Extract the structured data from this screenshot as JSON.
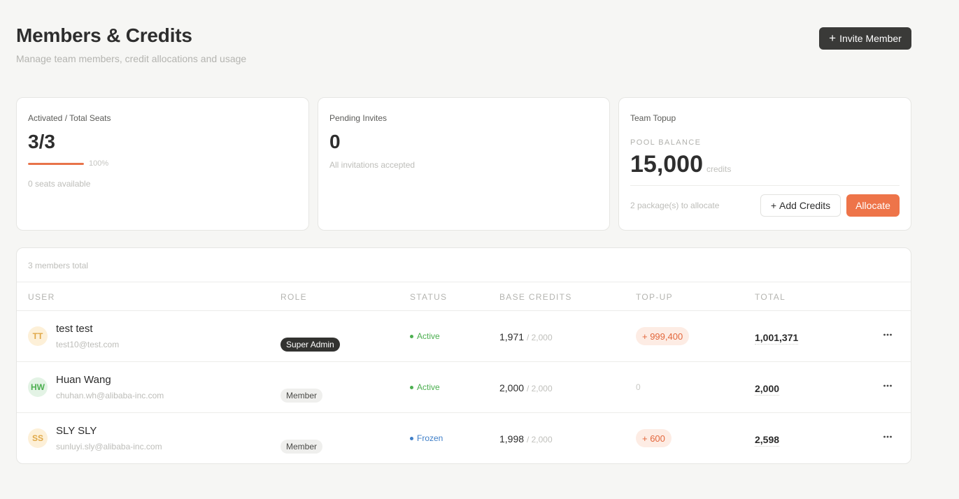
{
  "header": {
    "title": "Members & Credits",
    "subtitle": "Manage team members, credit allocations and usage",
    "invite_label": "Invite Member"
  },
  "seats": {
    "title": "Activated / Total Seats",
    "value": "3/3",
    "progress_percent": 100,
    "percent_label": "100%",
    "available_note": "0 seats available"
  },
  "invites": {
    "title": "Pending Invites",
    "value": "0",
    "note": "All invitations accepted"
  },
  "topup": {
    "title": "Team Topup",
    "pool_label": "POOL BALANCE",
    "pool_value": "15,000",
    "pool_unit": "credits",
    "packages_note": "2 package(s) to allocate",
    "add_credits_label": "Add Credits",
    "allocate_label": "Allocate"
  },
  "table": {
    "count_label": "3 members total",
    "columns": [
      "USER",
      "ROLE",
      "STATUS",
      "BASE CREDITS",
      "TOP-UP",
      "TOTAL"
    ],
    "rows": [
      {
        "initials": "TT",
        "avatar_bg": "#fdf0d8",
        "avatar_fg": "#e0a847",
        "name": "test test",
        "email": "test10@test.com",
        "role": "Super Admin",
        "role_type": "admin",
        "status": "Active",
        "status_color": "#4caf50",
        "base": "1,971",
        "base_max": "/ 2,000",
        "topup": "+ 999,400",
        "topup_has": true,
        "total": "1,001,371"
      },
      {
        "initials": "HW",
        "avatar_bg": "#e3f3e5",
        "avatar_fg": "#4caf50",
        "name": "Huan Wang",
        "email": "chuhan.wh@alibaba-inc.com",
        "role": "Member",
        "role_type": "member",
        "status": "Active",
        "status_color": "#4caf50",
        "base": "2,000",
        "base_max": "/ 2,000",
        "topup": "0",
        "topup_has": false,
        "total": "2,000"
      },
      {
        "initials": "SS",
        "avatar_bg": "#fdf0d8",
        "avatar_fg": "#e0a847",
        "name": "SLY SLY",
        "email": "sunluyi.sly@alibaba-inc.com",
        "role": "Member",
        "role_type": "member",
        "status": "Frozen",
        "status_color": "#3f7fc8",
        "base": "1,998",
        "base_max": "/ 2,000",
        "topup": "+ 600",
        "topup_has": true,
        "total": "2,598"
      }
    ]
  }
}
